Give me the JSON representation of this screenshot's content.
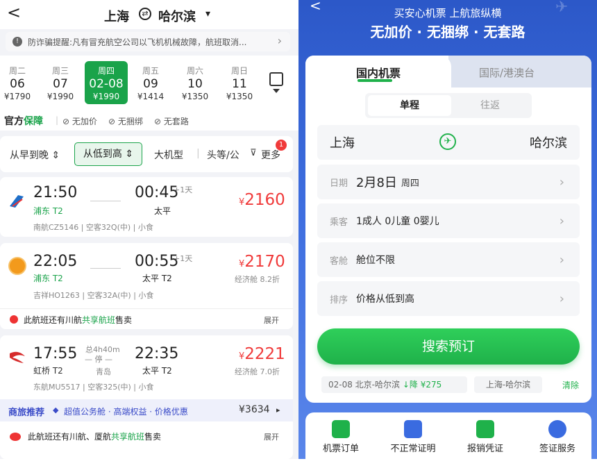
{
  "left": {
    "header": {
      "back": "<",
      "origin": "上海",
      "destination": "哈尔滨",
      "caret": "▾"
    },
    "notice": {
      "text": "防诈骗提醒:凡有冒充航空公司以飞机机械故障，航班取消...",
      "arrow": "›"
    },
    "dates": [
      {
        "weekday": "周二",
        "day": "06",
        "price": "¥1790"
      },
      {
        "weekday": "周三",
        "day": "07",
        "price": "¥1990"
      },
      {
        "weekday": "周四",
        "day": "02-08",
        "price": "¥1990"
      },
      {
        "weekday": "周五",
        "day": "09",
        "price": "¥1414"
      },
      {
        "weekday": "周六",
        "day": "10",
        "price": "¥1350"
      },
      {
        "weekday": "周日",
        "day": "11",
        "price": "¥1350"
      }
    ],
    "guarantee": {
      "brand_a": "官方",
      "brand_b": "保障",
      "items": [
        "无加价",
        "无捆绑",
        "无套路"
      ]
    },
    "sort": {
      "early_late": "从早到晚 ⇕",
      "low_high": "从低到高 ⇕",
      "big_plane": "大机型",
      "first_class": "头等/公",
      "more": "更多",
      "badge": "1"
    },
    "flights": [
      {
        "dep": "21:50",
        "arr": "00:45",
        "next_day": "+1天",
        "dep_ap": "浦东 T2",
        "arr_ap": "太平",
        "info": "南航CZ5146 | 空客32Q(中) | 小食",
        "price": "2160",
        "currency": "¥",
        "discount": ""
      },
      {
        "dep": "22:05",
        "arr": "00:55",
        "next_day": "+1天",
        "dep_ap": "浦东 T2",
        "arr_ap": "太平 T2",
        "info": "吉祥HO1263 | 空客32A(中) | 小食",
        "price": "2170",
        "currency": "¥",
        "discount": "经济舱 8.2折",
        "share": "此航班还有川航",
        "share_hl": "共享航班",
        "share_end": "售卖",
        "expand": "展开"
      },
      {
        "dep": "17:55",
        "arr": "22:35",
        "duration": "总4h40m",
        "stop": "停",
        "stop_city": "青岛",
        "dep_ap": "虹桥 T2",
        "arr_ap": "太平 T2",
        "info": "东航MU5517 | 空客325(中) | 小食",
        "price": "2221",
        "currency": "¥",
        "discount": "经济舱 7.0折"
      }
    ],
    "business": {
      "tag": "商旅推荐",
      "text": "超值公务舱 · 高端权益 · 价格优惠",
      "price": "¥3634",
      "arrow": "▸"
    },
    "share2": {
      "text": "此航班还有川航、厦航",
      "hl": "共享航班",
      "end": "售卖",
      "expand": "展开"
    }
  },
  "right": {
    "slogan1": "买安心机票 上航旅纵横",
    "slogan2": "无加价 · 无捆绑 · 无套路",
    "tabs": {
      "domestic": "国内机票",
      "intl": "国际/港澳台"
    },
    "trip": {
      "oneway": "单程",
      "round": "往返"
    },
    "route": {
      "from": "上海",
      "to": "哈尔滨"
    },
    "date": {
      "key": "日期",
      "value": "2月8日",
      "weekday": "周四"
    },
    "passenger": {
      "key": "乘客",
      "value": "1成人 0儿童 0婴儿"
    },
    "cabin": {
      "key": "客舱",
      "value": "舱位不限"
    },
    "order": {
      "key": "排序",
      "value": "价格从低到高"
    },
    "search": "搜索预订",
    "history": [
      {
        "text": "02-08  北京-哈尔滨",
        "drop": "↓降 ¥275"
      },
      {
        "text": "上海-哈尔滨"
      }
    ],
    "clear": "清除",
    "services": [
      "机票订单",
      "不正常证明",
      "报销凭证",
      "签证服务"
    ],
    "colors": {
      "green": "#1fb14a",
      "blue": "#3a6be0",
      "red": "#f03a3a"
    }
  }
}
